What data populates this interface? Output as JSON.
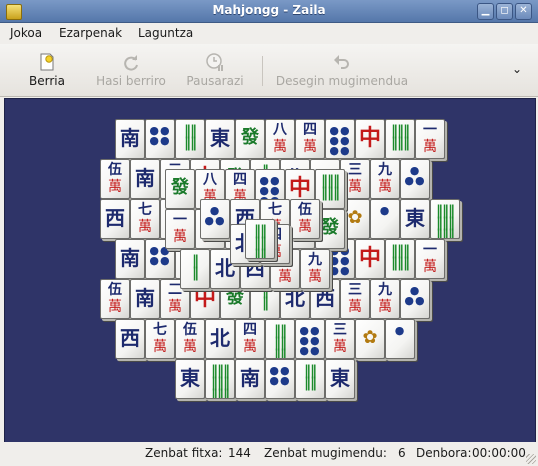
{
  "window": {
    "title": "Mahjongg - Zaila",
    "buttons": [
      {
        "name": "minimize",
        "glyph": "▁"
      },
      {
        "name": "maximize",
        "glyph": "◻"
      },
      {
        "name": "close",
        "glyph": "✕"
      }
    ]
  },
  "menubar": {
    "items": [
      "Jokoa",
      "Ezarpenak",
      "Laguntza"
    ]
  },
  "toolbar": {
    "new_label": "Berria",
    "restart_label": "Hasi berriro",
    "pause_label": "Pausarazi",
    "undo_label": "Desegin mugimendua",
    "overflow_glyph": "⌄"
  },
  "board": {
    "background": "#2f3468",
    "tiles": [
      {
        "kind": "wind",
        "main": "南"
      },
      {
        "kind": "dot",
        "main": "●●\n●●"
      },
      {
        "kind": "bamboo",
        "main": "‖‖\n‖‖"
      },
      {
        "kind": "wind",
        "main": "東"
      },
      {
        "kind": "dragon-g",
        "main": "發"
      },
      {
        "kind": "wan",
        "main": "八",
        "sub": "萬"
      },
      {
        "kind": "wan",
        "main": "四",
        "sub": "萬"
      },
      {
        "kind": "dot",
        "main": "●●\n●●\n●●"
      },
      {
        "kind": "dragon-r",
        "main": "中"
      },
      {
        "kind": "bamboo",
        "main": "‖‖‖\n‖‖‖"
      },
      {
        "kind": "wan",
        "main": "一",
        "sub": "萬"
      },
      {
        "kind": "wan",
        "main": "伍",
        "sub": "萬"
      },
      {
        "kind": "wind",
        "main": "南"
      },
      {
        "kind": "wan",
        "main": "二",
        "sub": "萬"
      },
      {
        "kind": "dragon-r",
        "main": "中"
      },
      {
        "kind": "dragon-g",
        "main": "發"
      },
      {
        "kind": "bamboo",
        "main": "‖\n‖"
      },
      {
        "kind": "wind",
        "main": "北"
      },
      {
        "kind": "wind",
        "main": "西"
      },
      {
        "kind": "wan",
        "main": "三",
        "sub": "萬"
      },
      {
        "kind": "wan",
        "main": "九",
        "sub": "萬"
      },
      {
        "kind": "dot",
        "main": "●\n●●"
      },
      {
        "kind": "wind",
        "main": "西"
      },
      {
        "kind": "wan",
        "main": "七",
        "sub": "萬"
      },
      {
        "kind": "wan",
        "main": "伍",
        "sub": "萬"
      },
      {
        "kind": "wind",
        "main": "北"
      },
      {
        "kind": "wan",
        "main": "四",
        "sub": "萬"
      },
      {
        "kind": "bamboo",
        "main": "‖‖\n‖‖\n‖‖"
      },
      {
        "kind": "dot",
        "main": "●●\n●●\n●●"
      },
      {
        "kind": "wan",
        "main": "三",
        "sub": "萬"
      },
      {
        "kind": "flower",
        "main": "✿"
      },
      {
        "kind": "dot",
        "main": "●"
      },
      {
        "kind": "wind",
        "main": "東"
      },
      {
        "kind": "bamboo",
        "main": "‖‖‖\n‖‖‖\n‖‖‖"
      }
    ]
  },
  "statusbar": {
    "tiles_label": "Zenbat fitxa:",
    "tiles_value": "144",
    "moves_label": "Zenbat mugimendu:",
    "moves_value": "6",
    "time_label": "Denbora:",
    "time_value": "00:00:00"
  }
}
